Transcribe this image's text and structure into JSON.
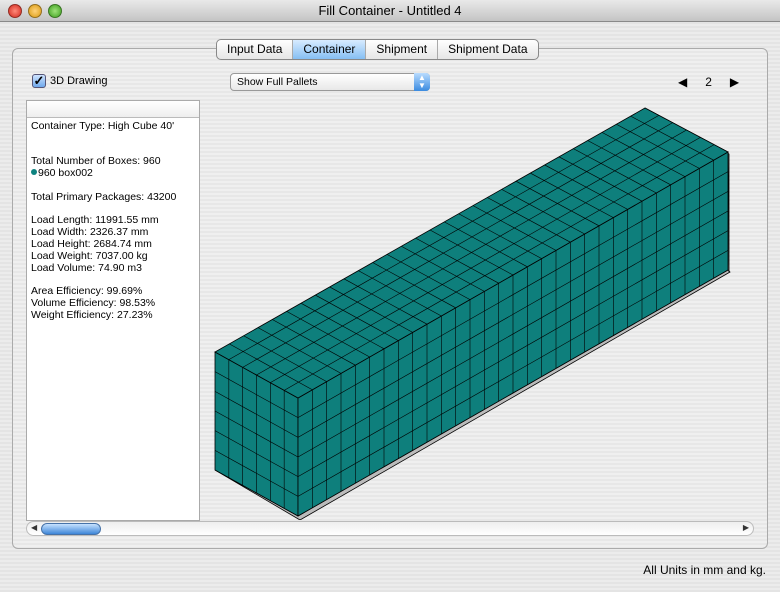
{
  "window": {
    "title": "Fill Container - Untitled 4"
  },
  "tabs": [
    {
      "label": "Input Data"
    },
    {
      "label": "Container",
      "active": true
    },
    {
      "label": "Shipment"
    },
    {
      "label": "Shipment Data"
    }
  ],
  "options": {
    "drawing_3d_label": "3D Drawing",
    "drawing_3d_checked": true,
    "view_select": "Show Full Pallets",
    "page": "2"
  },
  "info": {
    "container_type": "Container Type: High Cube 40'",
    "total_boxes": "Total Number of Boxes: 960",
    "box_item": "960 box002",
    "total_packages": "Total Primary Packages: 43200",
    "load_length": "Load Length: 11991.55 mm",
    "load_width": "Load Width: 2326.37 mm",
    "load_height": "Load Height: 2684.74 mm",
    "load_weight": "Load Weight: 7037.00 kg",
    "load_volume": "Load Volume: 74.90 m3",
    "area_eff": "Area Efficiency: 99.69%",
    "volume_eff": "Volume Efficiency: 98.53%",
    "weight_eff": "Weight Efficiency: 27.23%"
  },
  "colors": {
    "box": "#0e7f7c"
  },
  "status": "All Units in mm and kg."
}
